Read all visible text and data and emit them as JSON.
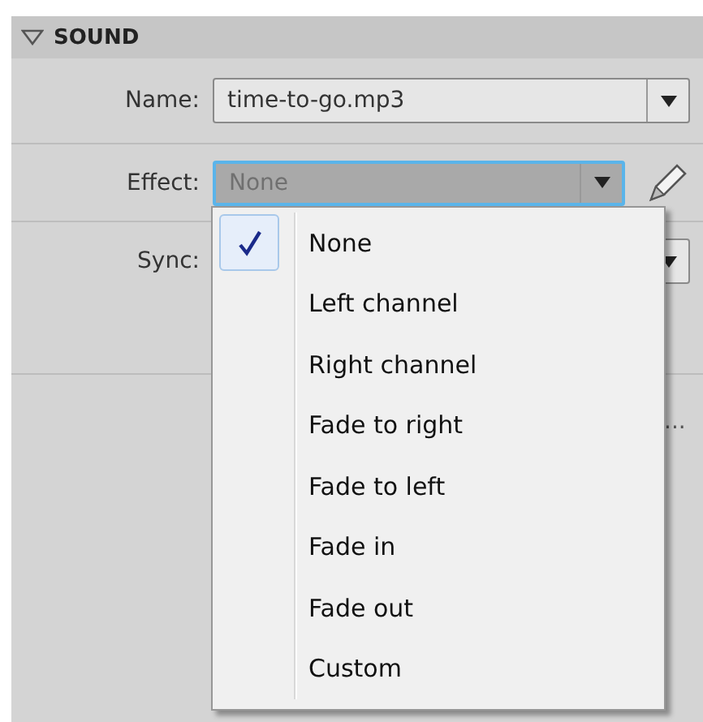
{
  "section": {
    "title": "SOUND",
    "expanded": true
  },
  "fields": [
    {
      "label": "Name:",
      "value": "time-to-go.mp3",
      "open": false,
      "edit_button": false
    },
    {
      "label": "Effect:",
      "value": "None",
      "open": true,
      "edit_button": true
    },
    {
      "label": "Sync:",
      "open": false,
      "edit_button": false
    }
  ],
  "more_text": "...",
  "menu": [
    {
      "label": "None",
      "selected": true
    },
    {
      "label": "Left channel",
      "selected": false
    },
    {
      "label": "Right channel",
      "selected": false
    },
    {
      "label": "Fade to right",
      "selected": false
    },
    {
      "label": "Fade to left",
      "selected": false
    },
    {
      "label": "Fade in",
      "selected": false
    },
    {
      "label": "Fade out",
      "selected": false
    },
    {
      "label": "Custom",
      "selected": false
    }
  ]
}
